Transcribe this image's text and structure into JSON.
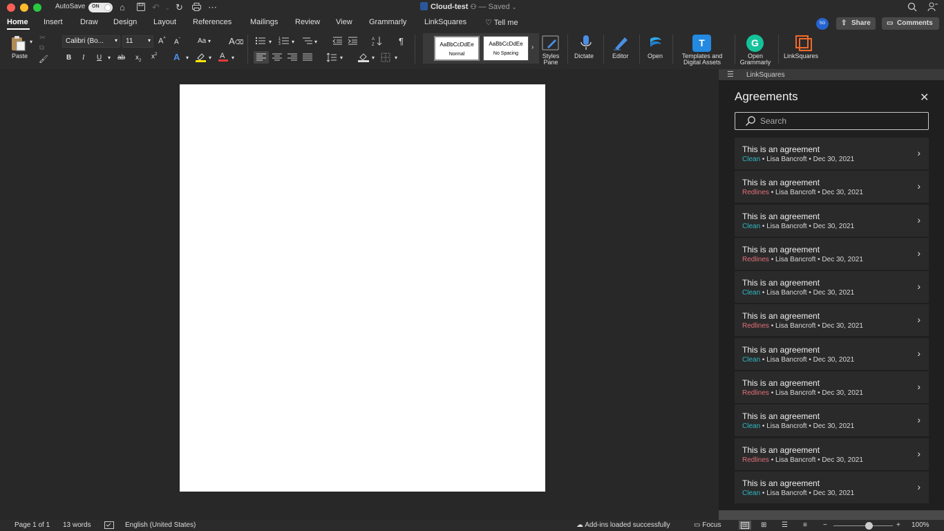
{
  "titlebar": {
    "autosave_label": "AutoSave",
    "toggle_state": "ON",
    "doc_name": "Cloud-test",
    "saved_status": "— Saved"
  },
  "tabs": [
    "Home",
    "Insert",
    "Draw",
    "Design",
    "Layout",
    "References",
    "Mailings",
    "Review",
    "View",
    "Grammarly",
    "LinkSquares"
  ],
  "tell_me": "Tell me",
  "avatar_initials": "SG",
  "share_label": "Share",
  "comments_label": "Comments",
  "ribbon": {
    "paste_label": "Paste",
    "font_name": "Calibri (Bo...",
    "font_size": "11",
    "grow_font": "A",
    "shrink_font": "A",
    "change_case": "Aa",
    "bold": "B",
    "italic": "I",
    "underline": "U",
    "strikethrough": "ab",
    "subscript": "x",
    "superscript": "x",
    "subscript_mark": "2",
    "superscript_mark": "2",
    "pilcrow": "¶",
    "styles": [
      {
        "preview": "AaBbCcDdEe",
        "name": "Normal"
      },
      {
        "preview": "AaBbCcDdEe",
        "name": "No Spacing"
      }
    ],
    "styles_pane_label": "Styles\nPane",
    "dictate_label": "Dictate",
    "editor_label": "Editor",
    "open_label": "Open",
    "templates_label": "Templates and\nDigital Assets",
    "open_grammarly_label": "Open\nGrammarly",
    "linksquares_label": "LinkSquares"
  },
  "pane": {
    "header_label": "LinkSquares",
    "title": "Agreements",
    "search_placeholder": "Search",
    "items": [
      {
        "title": "This is an agreement",
        "status": "Clean",
        "author": "Lisa Bancroft",
        "date": "Dec 30, 2021"
      },
      {
        "title": "This is an agreement",
        "status": "Redlines",
        "author": "Lisa Bancroft",
        "date": "Dec 30, 2021"
      },
      {
        "title": "This is an agreement",
        "status": "Clean",
        "author": "Lisa Bancroft",
        "date": "Dec 30, 2021"
      },
      {
        "title": "This is an agreement",
        "status": "Redlines",
        "author": "Lisa Bancroft",
        "date": "Dec 30, 2021"
      },
      {
        "title": "This is an agreement",
        "status": "Clean",
        "author": "Lisa Bancroft",
        "date": "Dec 30, 2021"
      },
      {
        "title": "This is an agreement",
        "status": "Redlines",
        "author": "Lisa Bancroft",
        "date": "Dec 30, 2021"
      },
      {
        "title": "This is an agreement",
        "status": "Clean",
        "author": "Lisa Bancroft",
        "date": "Dec 30, 2021"
      },
      {
        "title": "This is an agreement",
        "status": "Redlines",
        "author": "Lisa Bancroft",
        "date": "Dec 30, 2021"
      },
      {
        "title": "This is an agreement",
        "status": "Clean",
        "author": "Lisa Bancroft",
        "date": "Dec 30, 2021"
      },
      {
        "title": "This is an agreement",
        "status": "Redlines",
        "author": "Lisa Bancroft",
        "date": "Dec 30, 2021"
      },
      {
        "title": "This is an agreement",
        "status": "Clean",
        "author": "Lisa Bancroft",
        "date": "Dec 30, 2021"
      }
    ],
    "separator": " • "
  },
  "colors": {
    "clean": "#2fb8c6",
    "redlines": "#e0707a",
    "accent": "#2564cf"
  },
  "status": {
    "page": "Page 1 of 1",
    "words": "13 words",
    "language": "English (United States)",
    "addins": "Add-ins loaded successfully",
    "focus": "Focus",
    "zoom_fraction": 0.6,
    "zoom": "100%"
  }
}
